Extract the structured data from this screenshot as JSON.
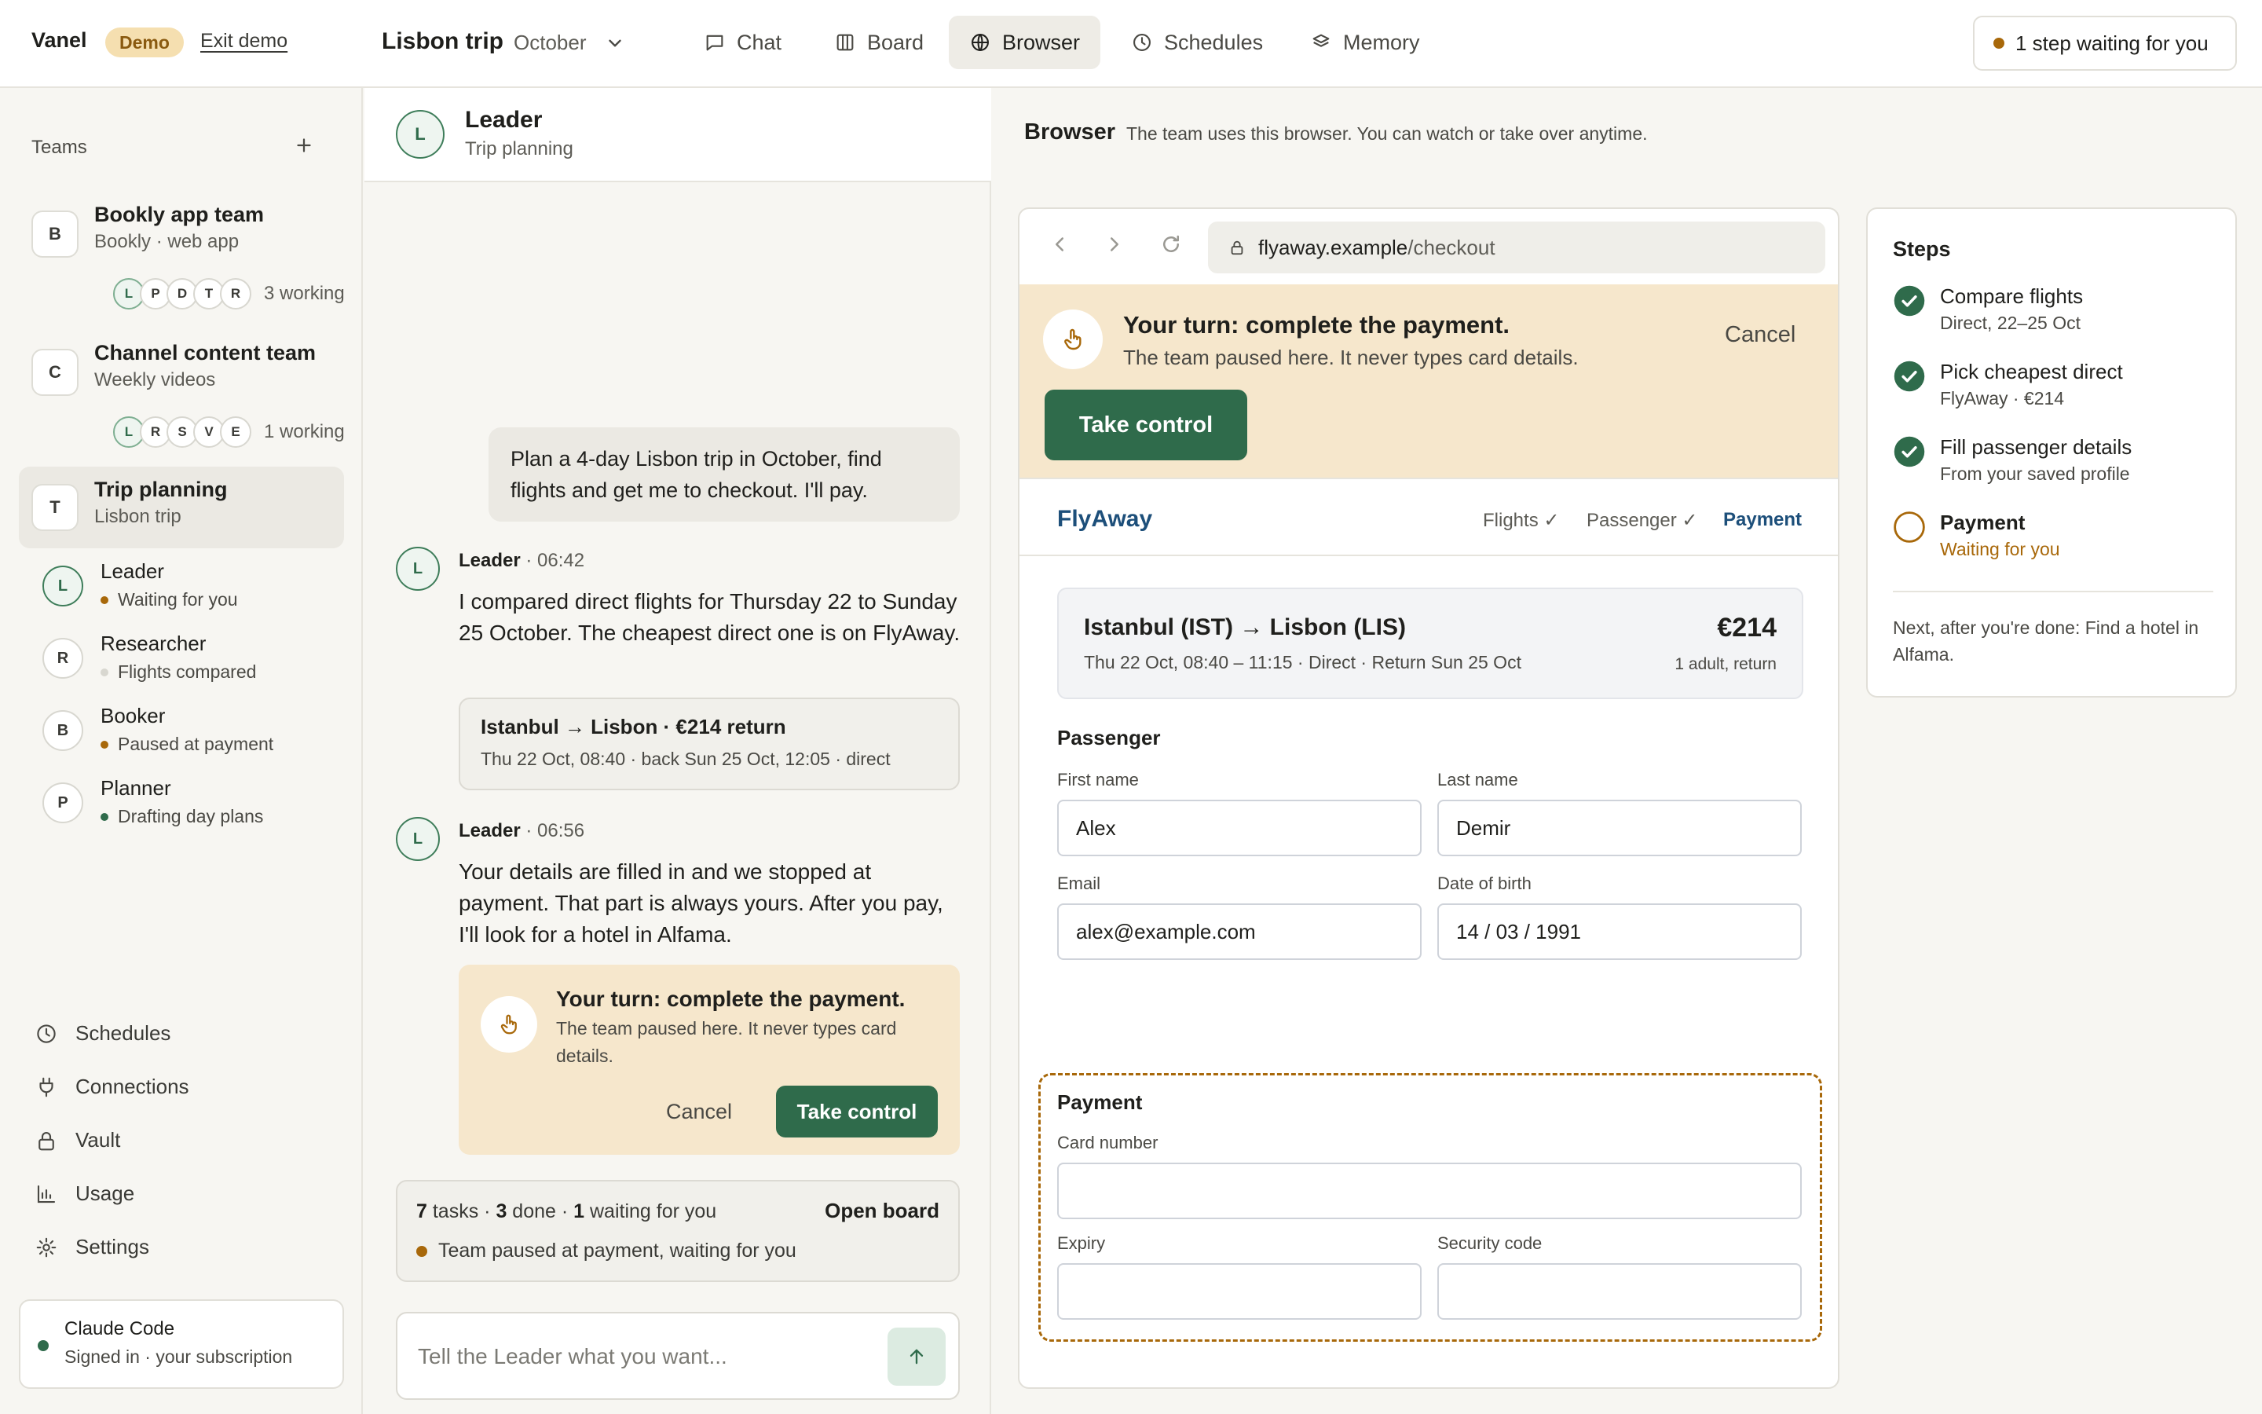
{
  "topbar": {
    "brand": "Vanel",
    "demo_badge": "Demo",
    "exit_demo": "Exit demo",
    "project_title": "Lisbon trip",
    "project_month": "October",
    "tabs": [
      {
        "label": "Chat",
        "icon": "chat-icon"
      },
      {
        "label": "Board",
        "icon": "board-icon"
      },
      {
        "label": "Browser",
        "icon": "globe-icon",
        "active": true
      },
      {
        "label": "Schedules",
        "icon": "clock-icon"
      },
      {
        "label": "Memory",
        "icon": "layers-icon"
      }
    ],
    "waiting_button": "1 step waiting for you"
  },
  "sidebar": {
    "teams_label": "Teams",
    "teams": [
      {
        "initial": "B",
        "name": "Bookly app team",
        "sub": "Bookly · web app",
        "members": [
          "L",
          "P",
          "D",
          "T",
          "R"
        ],
        "working": "3 working"
      },
      {
        "initial": "C",
        "name": "Channel content team",
        "sub": "Weekly videos",
        "members": [
          "L",
          "R",
          "S",
          "V",
          "E"
        ],
        "working": "1 working"
      },
      {
        "initial": "T",
        "name": "Trip planning",
        "sub": "Lisbon trip",
        "active": true
      }
    ],
    "agents": [
      {
        "initial": "L",
        "name": "Leader",
        "status": "Waiting for you",
        "status_color": "#a8680a"
      },
      {
        "initial": "R",
        "name": "Researcher",
        "status": "Flights compared",
        "status_color": "#d8d7d0"
      },
      {
        "initial": "B",
        "name": "Booker",
        "status": "Paused at payment",
        "status_color": "#a8680a"
      },
      {
        "initial": "P",
        "name": "Planner",
        "status": "Drafting day plans",
        "status_color": "#2f6b4b"
      }
    ],
    "nav": [
      {
        "label": "Schedules",
        "icon": "clock-icon"
      },
      {
        "label": "Connections",
        "icon": "plug-icon"
      },
      {
        "label": "Vault",
        "icon": "lock-icon"
      },
      {
        "label": "Usage",
        "icon": "bar-chart-icon"
      },
      {
        "label": "Settings",
        "icon": "gear-icon"
      }
    ],
    "account": {
      "name": "Claude Code",
      "sub": "Signed in · your subscription"
    }
  },
  "chat": {
    "header": {
      "initial": "L",
      "title": "Leader",
      "sub": "Trip planning"
    },
    "user_message": "Plan a 4-day Lisbon trip in October, find flights and get me to checkout. I'll pay.",
    "messages": [
      {
        "initial": "L",
        "author": "Leader",
        "time": "· 06:42",
        "text": "I compared direct flights for Thursday 22 to Sunday 25 October. The cheapest direct one is on FlyAway."
      },
      {
        "initial": "L",
        "author": "Leader",
        "time": "· 06:56",
        "text": "Your details are filled in and we stopped at payment. That part is always yours. After you pay, I'll look for a hotel in Alfama."
      }
    ],
    "flight_card": {
      "title": "Istanbul → Lisbon · €214 return",
      "sub": "Thu 22 Oct, 08:40 · back Sun 25 Oct, 12:05 · direct"
    },
    "pay_card": {
      "title": "Your turn: complete the payment.",
      "sub": "The team paused here. It never types card details.",
      "cancel": "Cancel",
      "take_control": "Take control"
    },
    "progress": {
      "tasks": "7",
      "tasks_label": "tasks ·",
      "done": "3",
      "done_label": "done ·",
      "waiting": "1",
      "waiting_label": "waiting for you",
      "open_board": "Open board",
      "status": "Team paused at payment, waiting for you"
    },
    "input_placeholder": "Tell the Leader what you want..."
  },
  "browser": {
    "title": "Browser",
    "subtitle": "The team uses this browser. You can watch or take over anytime.",
    "url_host": "flyaway.example",
    "url_path": "/checkout",
    "banner": {
      "title": "Your turn: complete the payment.",
      "sub": "The team paused here. It never types card details.",
      "cancel": "Cancel",
      "take_control": "Take control"
    },
    "site": {
      "logo": "FlyAway",
      "steps": [
        "Flights ✓",
        "Passenger ✓",
        "Payment"
      ],
      "summary": {
        "route": "Istanbul (IST) → Lisbon (LIS)",
        "detail": "Thu 22 Oct, 08:40 – 11:15 · Direct · Return Sun 25 Oct",
        "price": "€214",
        "pax": "1 adult, return"
      },
      "passenger_heading": "Passenger",
      "first_name_label": "First name",
      "first_name": "Alex",
      "last_name_label": "Last name",
      "last_name": "Demir",
      "email_label": "Email",
      "email": "alex@example.com",
      "dob_label": "Date of birth",
      "dob": "14 / 03 / 1991",
      "payment_heading": "Payment",
      "card_label": "Card number",
      "card_number": "",
      "expiry_label": "Expiry",
      "expiry": "",
      "security_label": "Security code",
      "security_code": ""
    }
  },
  "steps": {
    "title": "Steps",
    "items": [
      {
        "name": "Compare flights",
        "sub": "Direct, 22–25 Oct",
        "state": "done"
      },
      {
        "name": "Pick cheapest direct",
        "sub": "FlyAway · €214",
        "state": "done"
      },
      {
        "name": "Fill passenger details",
        "sub": "From your saved profile",
        "state": "done"
      },
      {
        "name": "Payment",
        "sub": "Waiting for you",
        "state": "current"
      }
    ],
    "next": "Next, after you're done: Find a hotel in Alfama."
  },
  "colors": {
    "accent_green": "#2f6b4b",
    "amber": "#a8680a",
    "brand_blue": "#1d4f7a",
    "banner_bg": "#f6e7cc"
  }
}
